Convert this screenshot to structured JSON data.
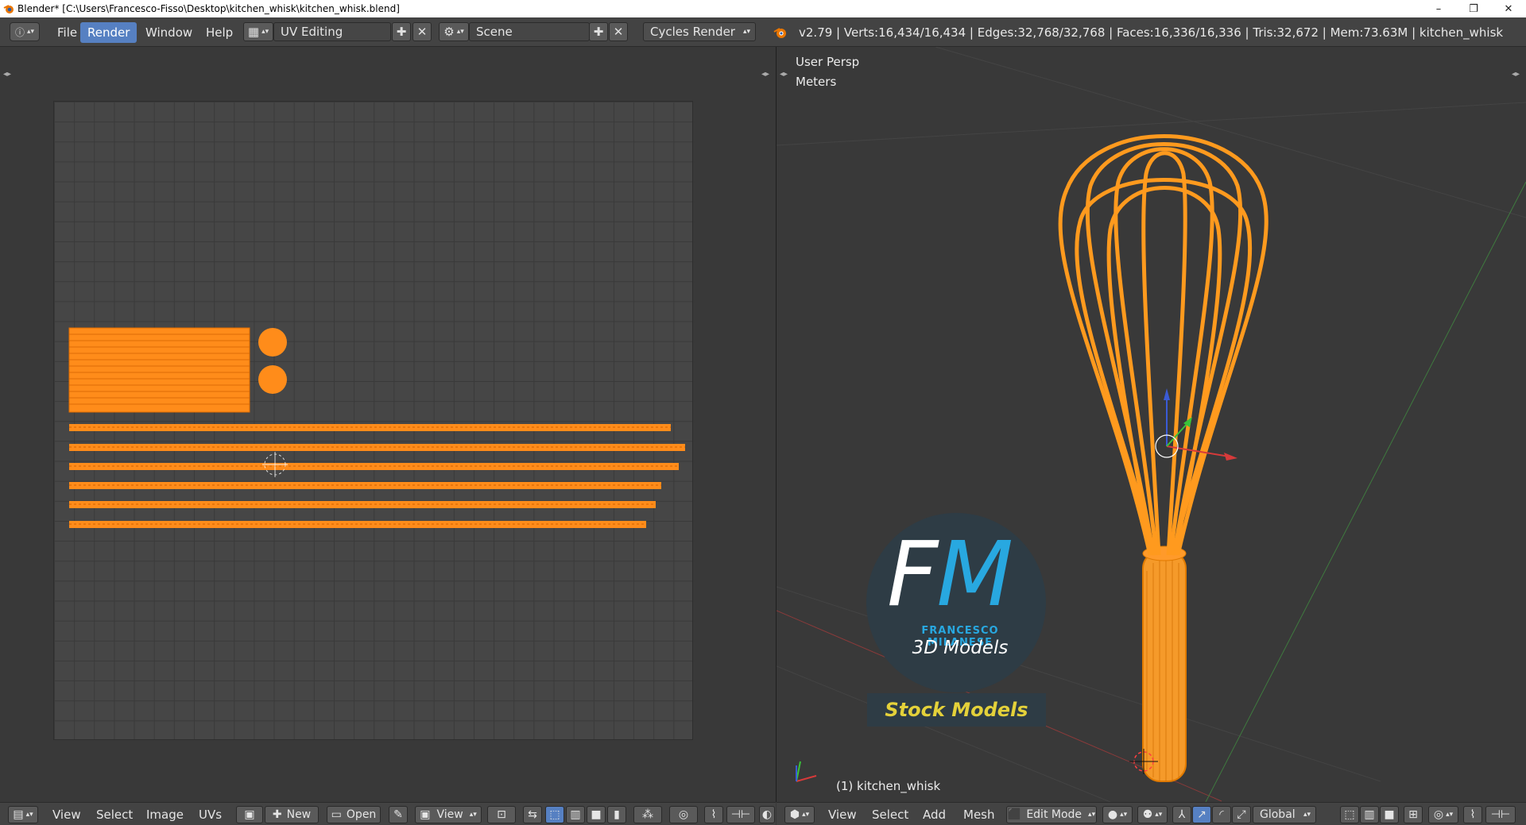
{
  "window": {
    "title": "Blender* [C:\\Users\\Francesco-Fisso\\Desktop\\kitchen_whisk\\kitchen_whisk.blend]",
    "controls": [
      "–",
      "❐",
      "✕"
    ]
  },
  "info_header": {
    "menus": [
      "File",
      "Render",
      "Window",
      "Help"
    ],
    "active_menu": "Render",
    "screen_layout": "UV Editing",
    "scene": "Scene",
    "render_engine": "Cycles Render",
    "stats": "v2.79 | Verts:16,434/16,434 | Edges:32,768/32,768 | Faces:16,336/16,336 | Tris:32,672 | Mem:73.63M | kitchen_whisk"
  },
  "viewport": {
    "view_name": "User Persp",
    "units": "Meters",
    "object_label": "(1) kitchen_whisk"
  },
  "uv_header": {
    "menus": [
      "View",
      "Select",
      "Image",
      "UVs"
    ],
    "new_label": "New",
    "open_label": "Open",
    "view_label": "View"
  },
  "view3d_header": {
    "menus": [
      "View",
      "Select",
      "Add",
      "Mesh"
    ],
    "mode": "Edit Mode",
    "orientation": "Global"
  },
  "logo": {
    "f": "F",
    "m": "M",
    "name": "FRANCESCO MILANESE",
    "subtitle": "3D Models",
    "banner": "Stock Models"
  },
  "colors": {
    "accent": "#5680c2",
    "mesh": "#ff8c1a",
    "header": "#434343",
    "background": "#393939"
  },
  "icons": [
    "blender-icon",
    "info-editor-icon",
    "layout-icon",
    "scene-icon",
    "add-icon",
    "close-icon",
    "image-editor-icon",
    "view3d-editor-icon",
    "pin-icon",
    "cube-icon",
    "sphere-shading-icon",
    "manipulator-icon"
  ]
}
